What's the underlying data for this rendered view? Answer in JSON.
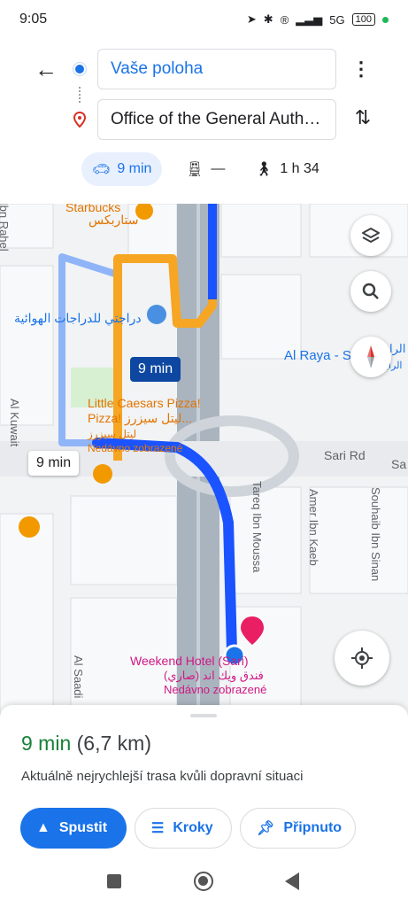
{
  "status": {
    "time": "9:05",
    "network": "5G",
    "battery": "100"
  },
  "route": {
    "from": "Vaše poloha",
    "to": "Office of the General Auth…"
  },
  "modes": {
    "car": "9 min",
    "transit": "—",
    "walk": "1 h 34"
  },
  "map": {
    "eta_primary": "9 min",
    "eta_alt": "9 min",
    "labels": {
      "starbucks_en": "Starbucks",
      "starbucks_ar": "ستاربكس",
      "bike_ar": "دراجتي للدراجات الهوائية",
      "pizza_en_1": "Little Caesars Pizza!",
      "pizza_en_2": "Pizza! ليتل سيزرز...",
      "pizza_ar": "ليتل سيزرز",
      "recent_1": "Nedávno zobrazené",
      "hotel_en": "Weekend Hotel (Sari)",
      "hotel_ar": "فندق ويك اند (صاري)",
      "recent_2": "Nedávno zobrazené",
      "al_raya": "Al Raya - S",
      "al_raya_ar_1": "الرا",
      "al_raya_ar_2": "الراية",
      "sari_rd": "Sari Rd",
      "sa": "Sa",
      "al_kuwait": "Al Kuwait",
      "tareq": "Tareq Ibn Moussa",
      "amer": "Amer Ibn Kaeb",
      "souhaib": "Souhaib Ibn Sinan",
      "al_saadi": "Al Saadi",
      "ibn_rahel": "Ibn Rahel"
    }
  },
  "sheet": {
    "time": "9 min",
    "distance": "(6,7 km)",
    "description": "Aktuálně nejrychlejší trasa kvůli dopravní situaci",
    "start": "Spustit",
    "steps": "Kroky",
    "pin": "Připnuto"
  },
  "colors": {
    "accent": "#1a73e8",
    "route": "#1a53ff",
    "alt_route": "#f6a623",
    "green_time": "#188038"
  }
}
